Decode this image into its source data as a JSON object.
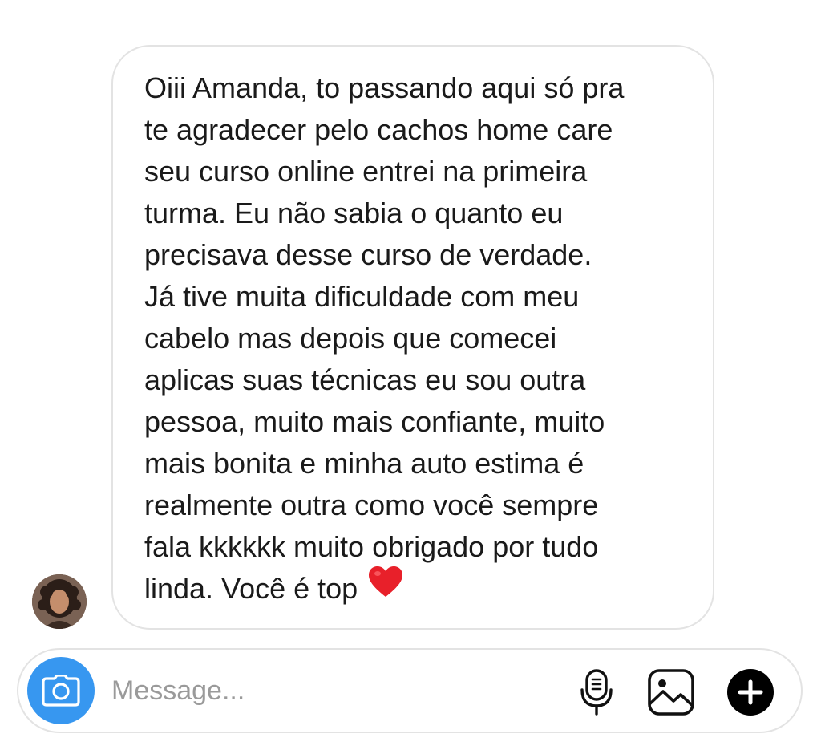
{
  "conversation": {
    "message": {
      "lines": [
        "Oiii Amanda, to passando aqui só pra",
        "te agradecer pelo cachos home care",
        "seu curso online entrei na primeira",
        "turma. Eu não sabia o quanto eu",
        "precisava desse curso de verdade.",
        "Já tive muita dificuldade com meu",
        "cabelo mas depois que comecei",
        "aplicas suas técnicas eu sou outra",
        "pessoa, muito mais confiante, muito",
        "mais bonita e minha auto estima é",
        "realmente outra como você sempre",
        "fala kkkkkk muito obrigado por tudo",
        "linda. Você é top"
      ],
      "emoji": "red-heart"
    },
    "sender_avatar": "avatar-photo"
  },
  "composer": {
    "placeholder": "Message...",
    "value": "",
    "icons": {
      "camera": "camera-icon",
      "mic": "microphone-icon",
      "gallery": "gallery-icon",
      "add": "plus-icon"
    }
  },
  "colors": {
    "camera_button": "#3797f0",
    "bubble_border": "#e3e3e3",
    "heart": "#e8202a",
    "text": "#1a1a1a",
    "placeholder": "#9a9a9a"
  }
}
